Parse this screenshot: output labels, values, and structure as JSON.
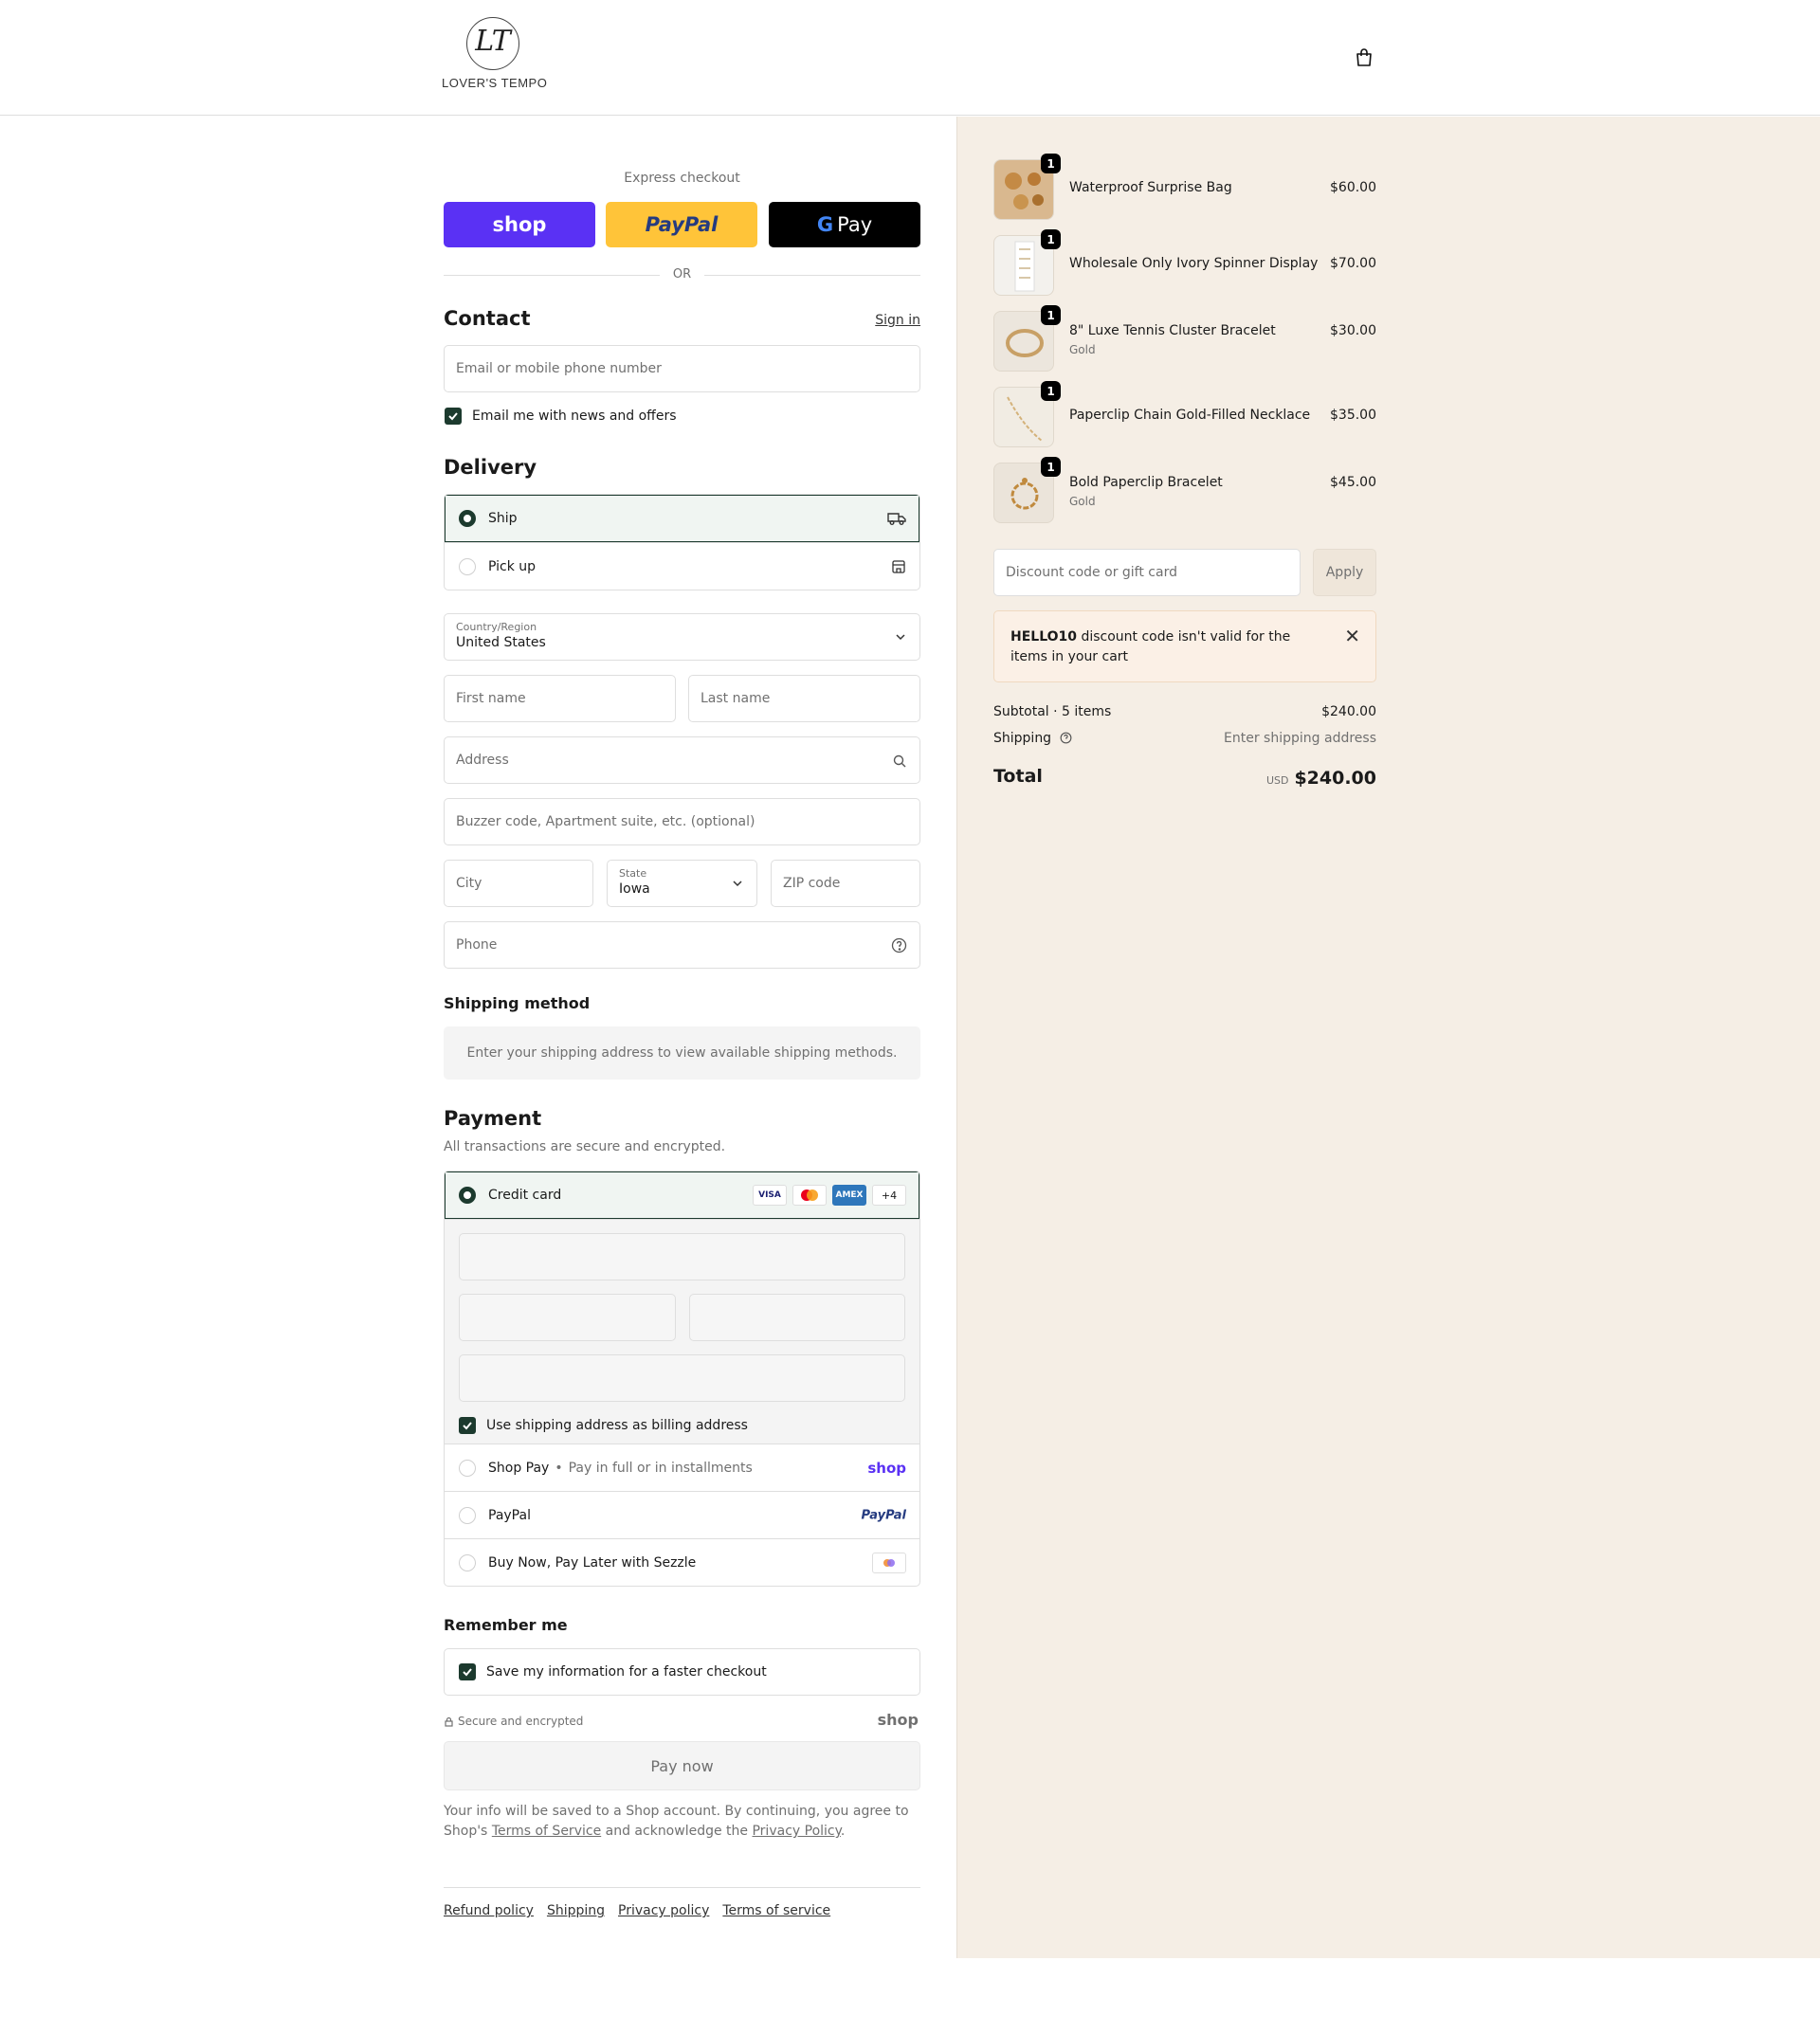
{
  "header": {
    "logo_text": "LOVER'S TEMPO",
    "logo_mark": "LT"
  },
  "express": {
    "title": "Express checkout",
    "shop_label": "shop",
    "paypal_label": "PayPal",
    "gpay_label": "Pay",
    "or_label": "OR"
  },
  "contact": {
    "title": "Contact",
    "sign_in": "Sign in",
    "email_placeholder": "Email or mobile phone number",
    "newsletter_label": "Email me with news and offers"
  },
  "delivery": {
    "title": "Delivery",
    "options": [
      {
        "label": "Ship",
        "selected": true
      },
      {
        "label": "Pick up",
        "selected": false
      }
    ],
    "country_label": "Country/Region",
    "country_value": "United States",
    "first_name_placeholder": "First name",
    "last_name_placeholder": "Last name",
    "address_placeholder": "Address",
    "apartment_placeholder": "Buzzer code, Apartment suite, etc. (optional)",
    "city_placeholder": "City",
    "state_label": "State",
    "state_value": "Iowa",
    "zip_placeholder": "ZIP code",
    "phone_placeholder": "Phone"
  },
  "shipping_method": {
    "title": "Shipping method",
    "note": "Enter your shipping address to view available shipping methods."
  },
  "payment": {
    "title": "Payment",
    "subtitle": "All transactions are secure and encrypted.",
    "credit_card_label": "Credit card",
    "card_brands": [
      "VISA",
      "Mastercard",
      "AMEX"
    ],
    "more_brands": "+4",
    "billing_label": "Use shipping address as billing address",
    "shop_pay_label": "Shop Pay",
    "shop_pay_sub": "Pay in full or in installments",
    "shop_pay_logo": "shop",
    "paypal_label": "PayPal",
    "paypal_logo": "PayPal",
    "sezzle_label": "Buy Now, Pay Later with Sezzle"
  },
  "remember": {
    "title": "Remember me",
    "save_label": "Save my information for a faster checkout",
    "secure_label": "Secure and encrypted",
    "shop_logo": "shop"
  },
  "pay_now": "Pay now",
  "legal": {
    "text_1": "Your info will be saved to a Shop account. By continuing, you agree to Shop's",
    "terms_link": "Terms of Service",
    "text_2": "and acknowledge the",
    "privacy_link": "Privacy Policy",
    "text_3": "."
  },
  "footer": {
    "links": [
      "Refund policy",
      "Shipping",
      "Privacy policy",
      "Terms of service"
    ]
  },
  "summary": {
    "items": [
      {
        "name": "Waterproof Surprise Bag",
        "variant": "",
        "price": "$60.00",
        "qty": "1"
      },
      {
        "name": "Wholesale Only Ivory Spinner Display",
        "variant": "",
        "price": "$70.00",
        "qty": "1"
      },
      {
        "name": "8\" Luxe Tennis Cluster Bracelet",
        "variant": "Gold",
        "price": "$30.00",
        "qty": "1"
      },
      {
        "name": "Paperclip Chain Gold-Filled Necklace",
        "variant": "",
        "price": "$35.00",
        "qty": "1"
      },
      {
        "name": "Bold Paperclip Bracelet",
        "variant": "Gold",
        "price": "$45.00",
        "qty": "1"
      }
    ],
    "discount_placeholder": "Discount code or gift card",
    "apply_label": "Apply",
    "alert_code": "HELLO10",
    "alert_text": "discount code isn't valid for the items in your cart",
    "subtotal_label": "Subtotal · 5 items",
    "subtotal_value": "$240.00",
    "shipping_label": "Shipping",
    "shipping_value": "Enter shipping address",
    "total_label": "Total",
    "currency": "USD",
    "total_value": "$240.00"
  },
  "colors": {
    "accent": "#1c3a2e",
    "shop_purple": "#5a31f4",
    "paypal_yellow": "#ffc439",
    "summary_bg": "#f5eee5"
  }
}
